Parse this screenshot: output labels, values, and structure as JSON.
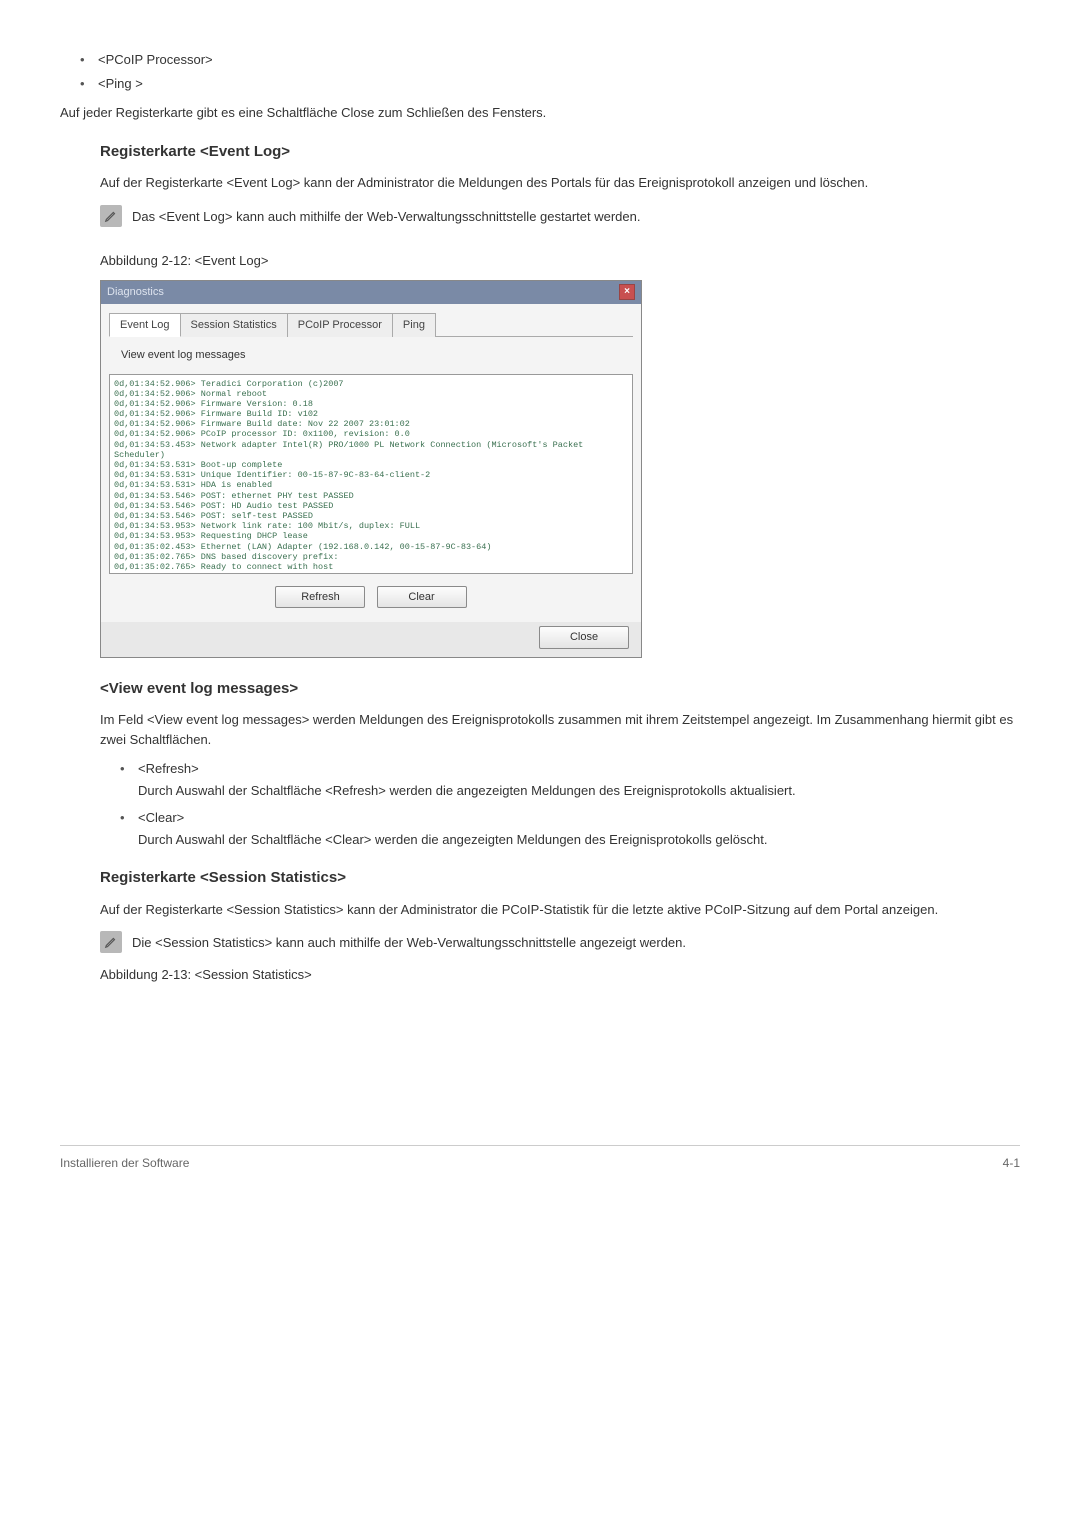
{
  "bullets_top": {
    "item1": "<PCoIP Processor>",
    "item2": "<Ping >"
  },
  "para_close": "Auf jeder Registerkarte gibt es eine Schaltfläche Close zum Schließen des Fensters.",
  "section_event": {
    "heading": "Registerkarte <Event Log>",
    "para": "Auf der Registerkarte <Event Log> kann der Administrator die Meldungen des Portals für das Ereignisprotokoll anzeigen und löschen.",
    "note": "Das <Event Log> kann auch mithilfe der Web-Verwaltungsschnittstelle gestartet werden.",
    "caption": "Abbildung 2-12: <Event Log>"
  },
  "dialog": {
    "title": "Diagnostics",
    "tabs": {
      "t1": "Event Log",
      "t2": "Session Statistics",
      "t3": "PCoIP Processor",
      "t4": "Ping"
    },
    "panel_label": "View event log messages",
    "log_text": "0d,01:34:52.906> Teradici Corporation (c)2007\n0d,01:34:52.906> Normal reboot\n0d,01:34:52.906> Firmware Version: 0.18\n0d,01:34:52.906> Firmware Build ID: v102\n0d,01:34:52.906> Firmware Build date: Nov 22 2007 23:01:02\n0d,01:34:52.906> PCoIP processor ID: 0x1100, revision: 0.0\n0d,01:34:53.453> Network adapter Intel(R) PRO/1000 PL Network Connection (Microsoft's Packet Scheduler)\n0d,01:34:53.531> Boot-up complete\n0d,01:34:53.531> Unique Identifier: 00-15-87-9C-83-64-client-2\n0d,01:34:53.531> HDA is enabled\n0d,01:34:53.546> POST: ethernet PHY test PASSED\n0d,01:34:53.546> POST: HD Audio test PASSED\n0d,01:34:53.546> POST: self-test PASSED\n0d,01:34:53.953> Network link rate: 100 Mbit/s, duplex: FULL\n0d,01:34:53.953> Requesting DHCP lease\n0d,01:35:02.453> Ethernet (LAN) Adapter (192.168.0.142, 00-15-87-9C-83-64)\n0d,01:35:02.765> DNS based discovery prefix:\n0d,01:35:02.765> Ready to connect with host",
    "buttons": {
      "refresh": "Refresh",
      "clear": "Clear",
      "close": "Close"
    }
  },
  "section_view": {
    "heading": "<View event log messages>",
    "para": "Im Feld <View event log messages> werden Meldungen des Ereignisprotokolls zusammen mit ihrem Zeitstempel angezeigt. Im Zusammenhang hiermit gibt es zwei Schaltflächen.",
    "refresh_label": "<Refresh>",
    "refresh_desc": "Durch Auswahl der Schaltfläche <Refresh> werden die angezeigten Meldungen des Ereignisprotokolls aktualisiert.",
    "clear_label": "<Clear>",
    "clear_desc": "Durch Auswahl der Schaltfläche <Clear> werden die angezeigten Meldungen des Ereignisprotokolls gelöscht."
  },
  "section_session": {
    "heading": "Registerkarte <Session Statistics>",
    "para": "Auf der Registerkarte <Session Statistics> kann der Administrator die PCoIP-Statistik für die letzte aktive PCoIP-Sitzung auf dem Portal anzeigen.",
    "note": "Die <Session Statistics> kann auch mithilfe der Web-Verwaltungsschnittstelle angezeigt werden.",
    "caption": "Abbildung 2-13: <Session Statistics>"
  },
  "footer": {
    "left": "Installieren der Software",
    "right": "4-1"
  }
}
